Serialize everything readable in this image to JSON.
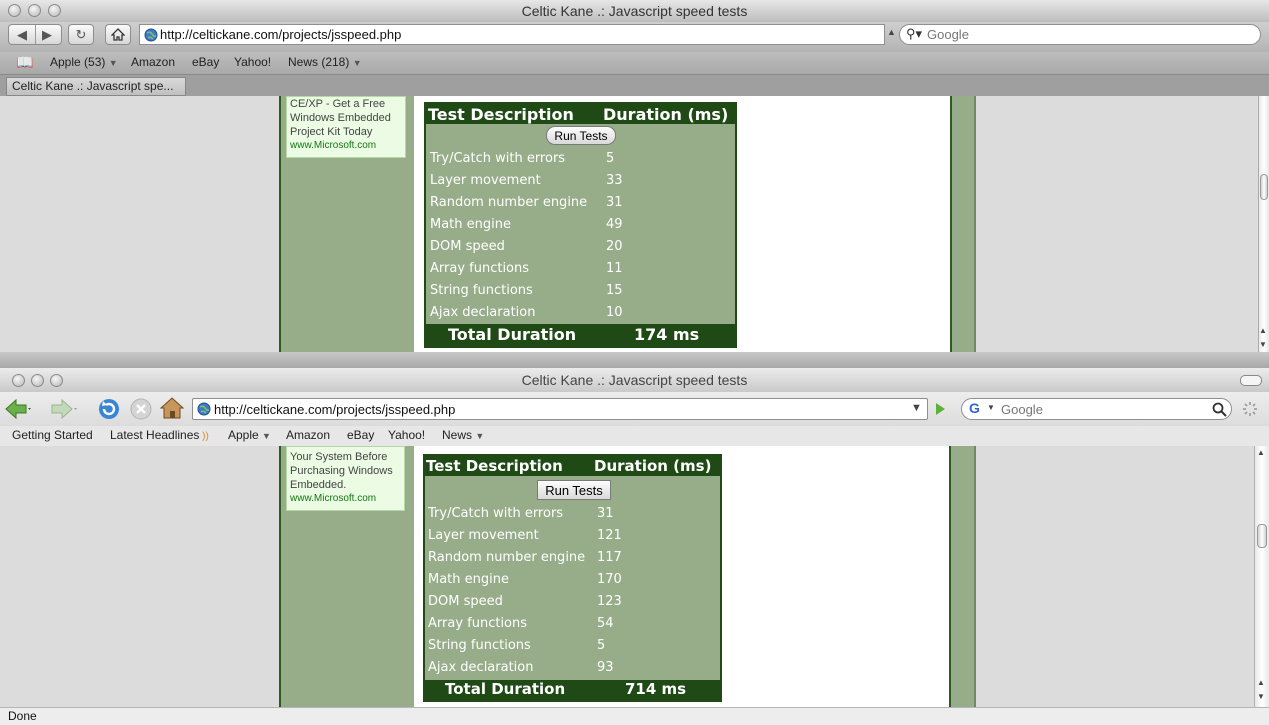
{
  "safari": {
    "title": "Celtic Kane .: Javascript speed tests",
    "url": "http://celtickane.com/projects/jsspeed.php",
    "search_placeholder": "Google",
    "bookmarks": {
      "apple": "Apple (53)",
      "amazon": "Amazon",
      "ebay": "eBay",
      "yahoo": "Yahoo!",
      "news": "News (218)"
    },
    "tab_label": "Celtic Kane .: Javascript spe...",
    "ad": {
      "lines": [
        "CE/XP - Get a Free",
        "Windows Embedded",
        "Project Kit Today"
      ],
      "link": "www.Microsoft.com"
    },
    "results": {
      "header_desc": "Test Description",
      "header_dur": "Duration (ms)",
      "run_button": "Run Tests",
      "rows": [
        {
          "desc": "Try/Catch with errors",
          "value": "5"
        },
        {
          "desc": "Layer movement",
          "value": "33"
        },
        {
          "desc": "Random number engine",
          "value": "31"
        },
        {
          "desc": "Math engine",
          "value": "49"
        },
        {
          "desc": "DOM speed",
          "value": "20"
        },
        {
          "desc": "Array functions",
          "value": "11"
        },
        {
          "desc": "String functions",
          "value": "15"
        },
        {
          "desc": "Ajax declaration",
          "value": "10"
        }
      ],
      "total_label": "Total Duration",
      "total_value": "174 ms"
    }
  },
  "firefox": {
    "title": "Celtic Kane .: Javascript speed tests",
    "url": "http://celtickane.com/projects/jsspeed.php",
    "search_placeholder": "Google",
    "bookmarks": {
      "getting_started": "Getting Started",
      "latest_headlines": "Latest Headlines",
      "apple": "Apple",
      "amazon": "Amazon",
      "ebay": "eBay",
      "yahoo": "Yahoo!",
      "news": "News"
    },
    "ad": {
      "lines": [
        "Your System Before",
        "Purchasing Windows",
        "Embedded."
      ],
      "link": "www.Microsoft.com"
    },
    "results": {
      "header_desc": "Test Description",
      "header_dur": "Duration (ms)",
      "run_button": "Run Tests",
      "rows": [
        {
          "desc": "Try/Catch with errors",
          "value": "31"
        },
        {
          "desc": "Layer movement",
          "value": "121"
        },
        {
          "desc": "Random number engine",
          "value": "117"
        },
        {
          "desc": "Math engine",
          "value": "170"
        },
        {
          "desc": "DOM speed",
          "value": "123"
        },
        {
          "desc": "Array functions",
          "value": "54"
        },
        {
          "desc": "String functions",
          "value": "5"
        },
        {
          "desc": "Ajax declaration",
          "value": "93"
        }
      ],
      "total_label": "Total Duration",
      "total_value": "714 ms"
    },
    "status": "Done"
  },
  "colors": {
    "page_green": "#97ad8a",
    "dark_green": "#1f4a16",
    "ad_bg": "#ecfbe3",
    "ad_link": "#107a10"
  },
  "icons": {
    "safari": [
      "back-icon",
      "forward-icon",
      "reload-icon",
      "home-icon",
      "globe-icon",
      "search-icon",
      "bookmarks-book-icon"
    ],
    "firefox": [
      "back-arrow-icon",
      "forward-arrow-icon",
      "reload-icon",
      "stop-icon",
      "home-icon",
      "globe-icon",
      "go-arrow-icon",
      "google-g-icon",
      "magnifier-icon",
      "loading-throbber-icon",
      "rss-icon"
    ]
  }
}
